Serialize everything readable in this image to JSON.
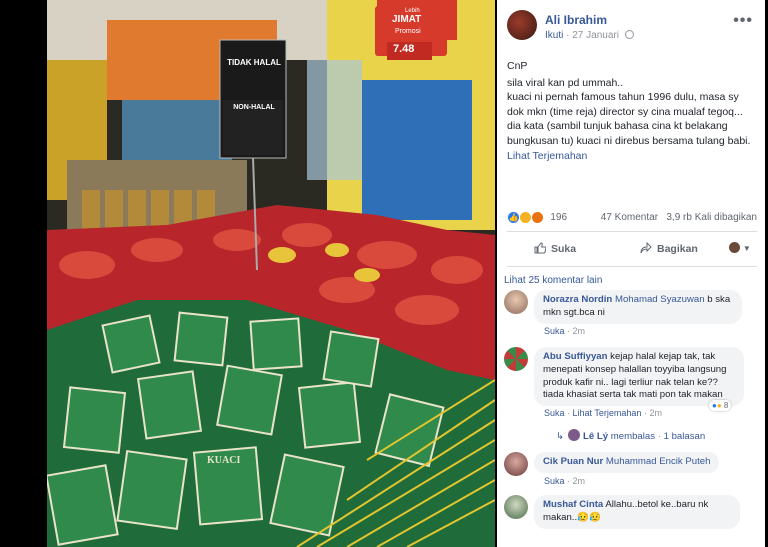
{
  "photo": {
    "sign_title": "TIDAK HALAL",
    "sign_subtitle": "NON-HALAL",
    "promo_top": "Lebih",
    "promo_brand": "JIMAT",
    "promo_label": "Promosi",
    "promo_price": "7.48",
    "product_label": "KUACI"
  },
  "post": {
    "author": "Ali Ibrahim",
    "follow": "Ikuti",
    "date": "27 Januari",
    "lines": [
      "CnP",
      "sila viral kan pd ummah..",
      "kuaci ni pernah famous tahun 1996 dulu, masa sy",
      "dok mkn (time reja) director sy cina mualaf tegoq...",
      "dia kata (sambil tunjuk bahasa cina kt belakang",
      "bungkusan tu) kuaci ni direbus bersama tulang babi."
    ],
    "see_translation": "Lihat Terjemahan",
    "reaction_count": "196",
    "comments_count": "47 Komentar",
    "shares_count": "3,9 rb Kali dibagikan",
    "like_label": "Suka",
    "share_label": "Bagikan"
  },
  "comments": {
    "more_label": "Lihat 25 komentar lain",
    "items": [
      {
        "name": "Norazra Nordin",
        "tag": "Mohamad Syazuwan",
        "text_first": " b ska",
        "text_rest": [
          "mkn sgt.bca ni"
        ],
        "like": "Suka",
        "time": "2m"
      },
      {
        "name": "Abu Suffiyyan",
        "tag": "",
        "text_first": " kejap halal kejap tak, tak",
        "text_rest": [
          "menepati konsep halallan toyyiba langsung",
          "produk kafir ni.. lagi terliur nak telan ke??",
          "tiada khasiat serta tak mati pon tak makan"
        ],
        "like": "Suka",
        "translate": "Lihat Terjemahan",
        "time": "2m",
        "reactions": "8",
        "reply_name": "Lê Lý",
        "reply_text": "membalas",
        "reply_count": "1 balasan"
      },
      {
        "name": "Cik Puan Nur",
        "tag": "Muhammad Encik Puteh",
        "text_first": "",
        "text_rest": [],
        "like": "Suka",
        "time": "2m"
      },
      {
        "name": "Mushaf Cinta",
        "tag": "",
        "text_first": " Allahu..betol ke..baru nk",
        "text_rest": [
          "makan..😥😥"
        ],
        "like": "Suka",
        "time": "2m"
      }
    ]
  },
  "colors": {
    "link": "#385898",
    "muted": "#90949c",
    "bubble": "#f2f3f5",
    "like_blue": "#2078f4"
  }
}
